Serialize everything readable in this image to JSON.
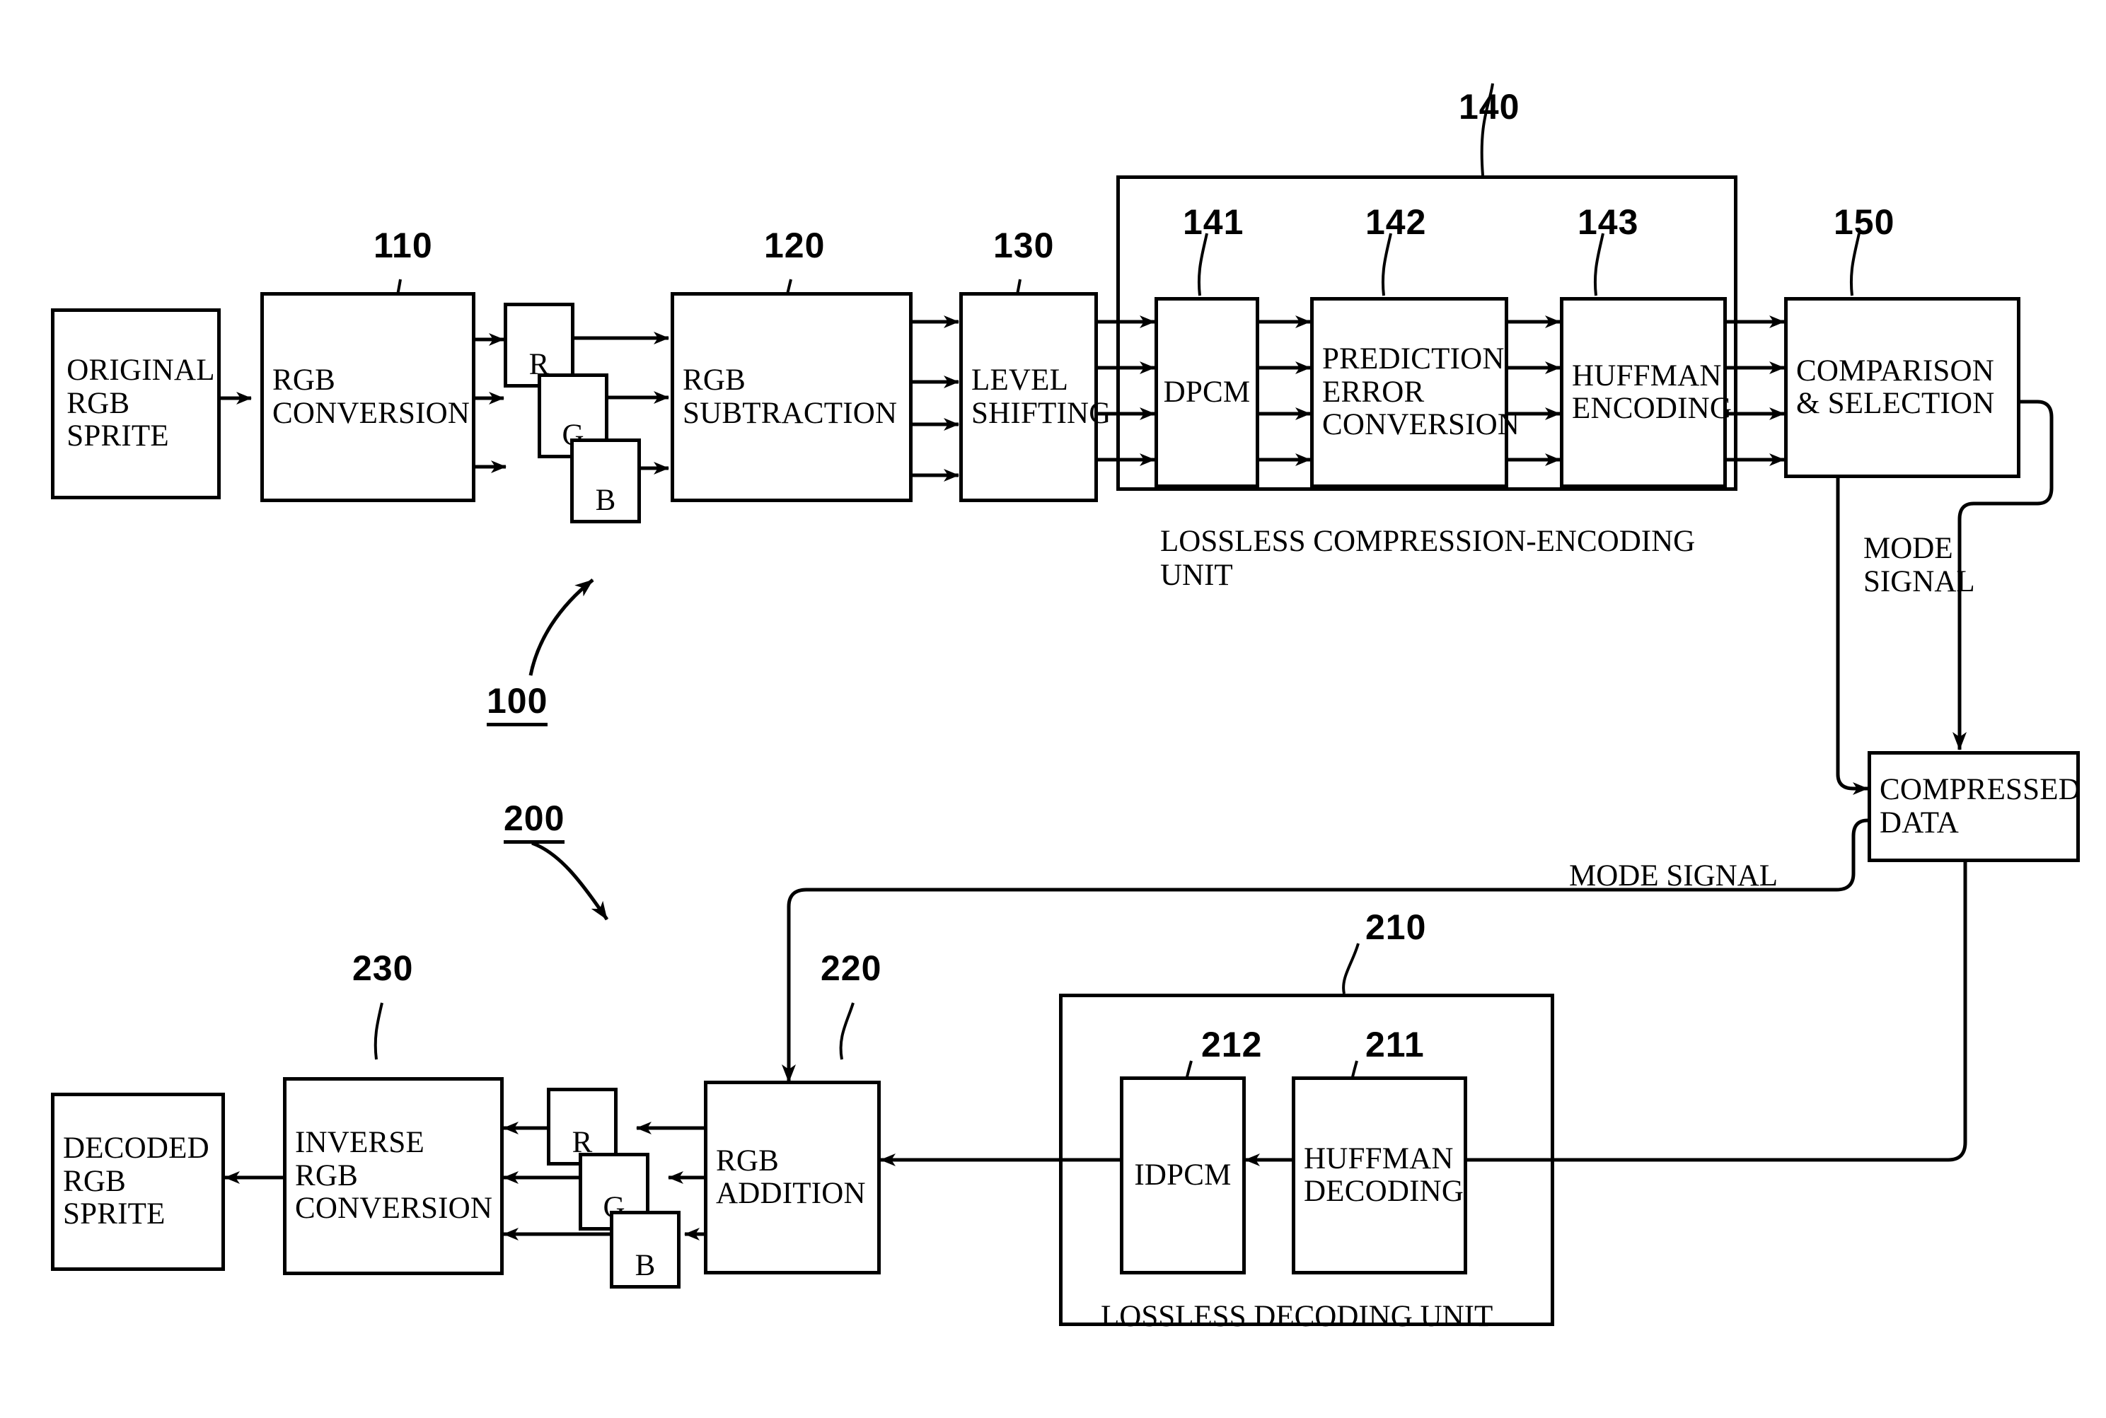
{
  "figure": {
    "type": "patent-block-diagram",
    "title": "RGB sprite lossless compression encoder and decoder block diagram"
  },
  "encoder": {
    "ref": "100",
    "blocks": {
      "source": {
        "label": "ORIGINAL\nRGB\nSPRITE"
      },
      "rgb_conversion": {
        "ref": "110",
        "label": "RGB\nCONVERSION"
      },
      "channels": [
        {
          "label": "R"
        },
        {
          "label": "G"
        },
        {
          "label": "B"
        }
      ],
      "rgb_subtraction": {
        "ref": "120",
        "label": "RGB\nSUBTRACTION"
      },
      "level_shifting": {
        "ref": "130",
        "label": "LEVEL\nSHIFTING"
      },
      "dpcm": {
        "ref": "141",
        "label": "DPCM"
      },
      "prediction_error_conversion": {
        "ref": "142",
        "label": "PREDICTION\nERROR\nCONVERSION"
      },
      "huffman_encoding": {
        "ref": "143",
        "label": "HUFFMAN\nENCODING"
      },
      "comparison_selection": {
        "ref": "150",
        "label": "COMPARISON\n&  SELECTION"
      }
    },
    "lossless_unit": {
      "ref": "140",
      "caption": "LOSSLESS COMPRESSION-ENCODING\nUNIT"
    },
    "mode_signal_label": "MODE\nSIGNAL"
  },
  "store": {
    "compressed_data": {
      "label": "COMPRESSED\nDATA"
    },
    "mode_signal_label": "MODE SIGNAL"
  },
  "decoder": {
    "ref": "200",
    "blocks": {
      "huffman_decoding": {
        "ref": "211",
        "label": "HUFFMAN\nDECODING"
      },
      "idpcm": {
        "ref": "212",
        "label": "IDPCM"
      },
      "rgb_addition": {
        "ref": "220",
        "label": "RGB\nADDITION"
      },
      "channels": [
        {
          "label": "R"
        },
        {
          "label": "G"
        },
        {
          "label": "B"
        }
      ],
      "inverse_rgb_conversion": {
        "ref": "230",
        "label": "INVERSE\nRGB\nCONVERSION"
      },
      "sink": {
        "label": "DECODED\nRGB\nSPRITE"
      }
    },
    "lossless_unit": {
      "ref": "210",
      "caption": "LOSSLESS DECODING UNIT"
    }
  },
  "colors": {
    "ink": "#000000",
    "paper": "#ffffff"
  }
}
